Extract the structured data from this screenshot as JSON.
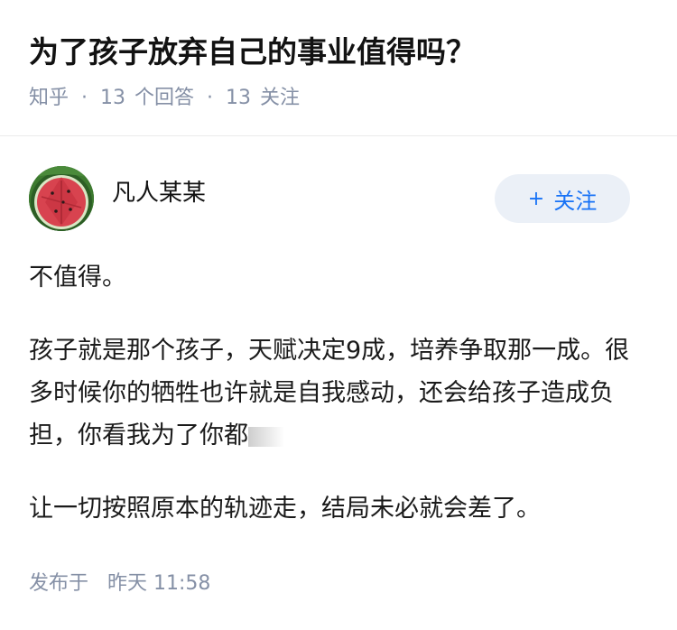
{
  "question": {
    "title": "为了孩子放弃自己的事业值得吗？",
    "source": "知乎",
    "answer_count": "13",
    "answer_label": "个回答",
    "follower_count": "13",
    "follower_label": "关注"
  },
  "author": {
    "name": "凡人某某",
    "avatar_icon": "watermelon-avatar",
    "follow_label": "关注",
    "follow_color": "#1772f6"
  },
  "answer": {
    "paragraphs": [
      "不值得。",
      "孩子就是那个孩子，天赋决定9成，培养争取那一成。很多时候你的牺牲也许就是自我感动，还会给孩子造成负担，你看我为了你都",
      "让一切按照原本的轨迹走，结局未必就会差了。"
    ]
  },
  "footer": {
    "publish_label": "发布于",
    "publish_time": "昨天 11:58"
  }
}
